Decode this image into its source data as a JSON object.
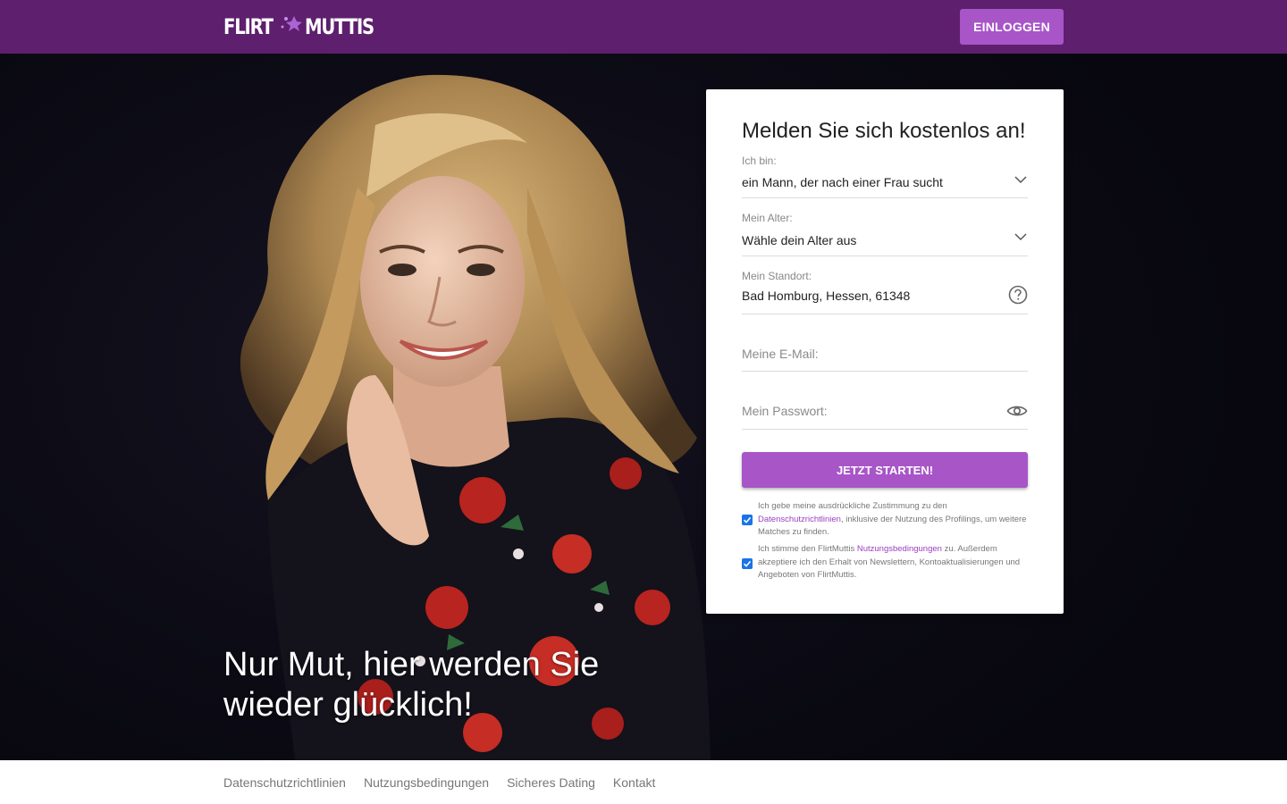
{
  "header": {
    "logo": {
      "left": "FLIRT",
      "right": "MUTTIS"
    },
    "login_label": "EINLOGGEN"
  },
  "hero": {
    "headline_line1": "Nur Mut, hier werden Sie",
    "headline_line2": "wieder glücklich!"
  },
  "form": {
    "title": "Melden Sie sich kostenlos an!",
    "iam": {
      "label": "Ich bin:",
      "value": "ein Mann, der nach einer Frau sucht"
    },
    "age": {
      "label": "Mein Alter:",
      "value": "Wähle dein Alter aus"
    },
    "location": {
      "label": "Mein Standort:",
      "value": "Bad Homburg, Hessen, 61348"
    },
    "email": {
      "placeholder": "Meine E-Mail:"
    },
    "password": {
      "placeholder": "Mein Passwort:"
    },
    "submit_label": "JETZT STARTEN!",
    "consent1": {
      "before": "Ich gebe meine ausdrückliche Zustimmung zu den ",
      "link": "Datenschutzrichtlinien",
      "after": ", inklusive der Nutzung des Profilings, um weitere Matches zu finden.",
      "checked": true
    },
    "consent2": {
      "before": "Ich stimme den FlirtMuttis ",
      "link": "Nutzungsbedingungen",
      "after": " zu. Außerdem akzeptiere ich den Erhalt von Newslettern, Kontoaktualisierungen und Angeboten von FlirtMuttis.",
      "checked": true
    }
  },
  "footer": {
    "links": [
      "Datenschutzrichtlinien",
      "Nutzungsbedingungen",
      "Sicheres Dating",
      "Kontakt"
    ]
  },
  "colors": {
    "header_bg": "#5e1f6e",
    "accent": "#a855c8",
    "link": "#9b3fc0",
    "checkbox": "#1a73e8"
  },
  "icons": {
    "dropdown": "chevron-down-icon",
    "help": "question-circle-icon",
    "password_toggle": "eye-icon",
    "checkbox": "checkmark-icon"
  }
}
